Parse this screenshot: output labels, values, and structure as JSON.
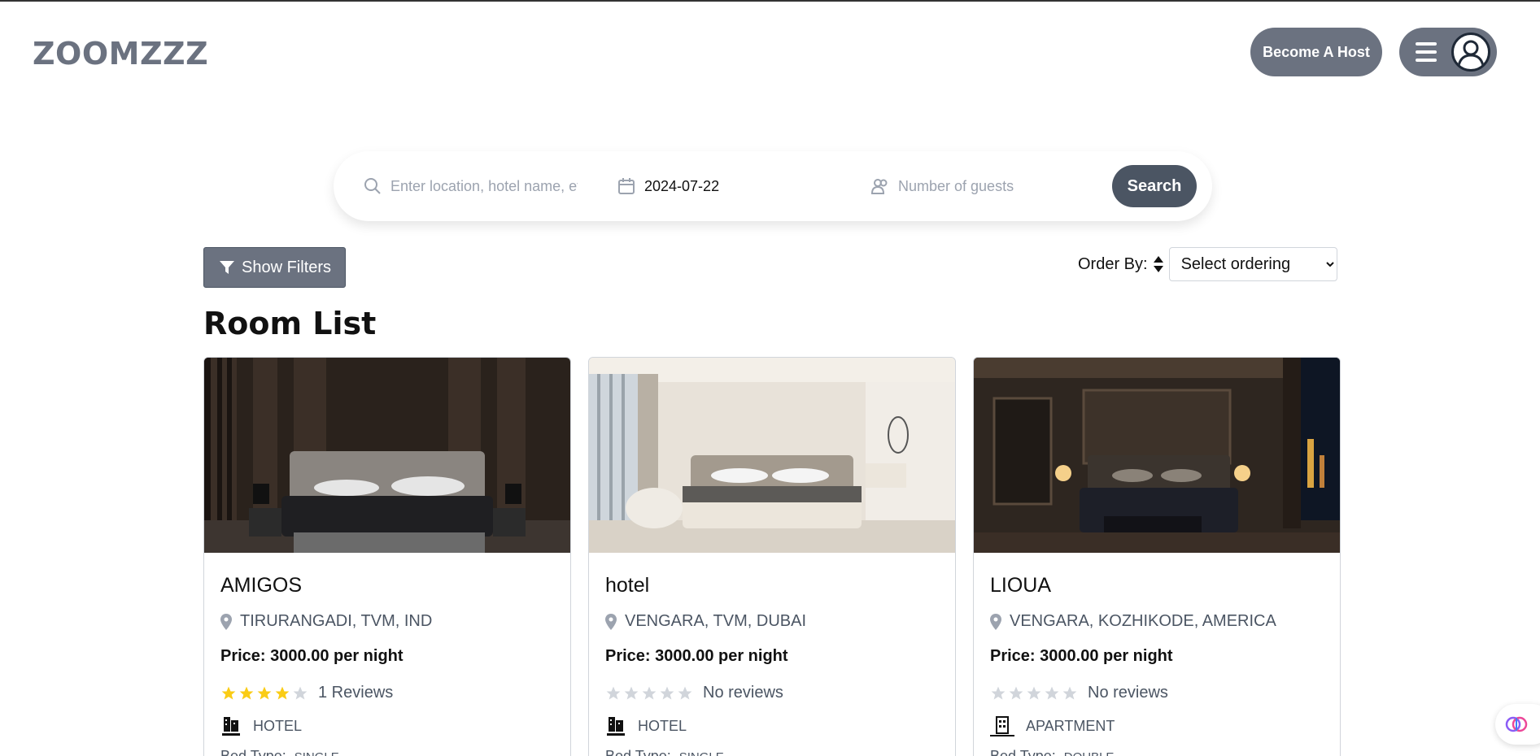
{
  "brand": {
    "logo": "ZOOMZZZ"
  },
  "header": {
    "become_host_label": "Become A Host"
  },
  "search": {
    "location_placeholder": "Enter location, hotel name, etc",
    "date_value": "2024-07-22",
    "guests_placeholder": "Number of guests",
    "button_label": "Search"
  },
  "toolbar": {
    "filters_label": "Show Filters",
    "order_label": "Order By:",
    "order_selected": "Select ordering"
  },
  "page": {
    "title": "Room List"
  },
  "rooms": [
    {
      "name": "AMIGOS",
      "location": "TIRURANGADI, TVM, IND",
      "price": "Price: 3000.00 per night",
      "rating": 4,
      "reviews": "1 Reviews",
      "type": "HOTEL",
      "bed_label": "Bed Type:",
      "bed_type": "SINGLE"
    },
    {
      "name": "hotel",
      "location": "VENGARA, TVM, DUBAI",
      "price": "Price: 3000.00 per night",
      "rating": 0,
      "reviews": "No reviews",
      "type": "HOTEL",
      "bed_label": "Bed Type:",
      "bed_type": "SINGLE"
    },
    {
      "name": "LIOUA",
      "location": "VENGARA, KOZHIKODE, AMERICA",
      "price": "Price: 3000.00 per night",
      "rating": 0,
      "reviews": "No reviews",
      "type": "APARTMENT",
      "bed_label": "Bed Type:",
      "bed_type": "DOUBLE"
    }
  ],
  "colors": {
    "accent": "#6b7280",
    "dark": "#4b5563",
    "star_on": "#facc15",
    "star_off": "#d1d5db"
  }
}
